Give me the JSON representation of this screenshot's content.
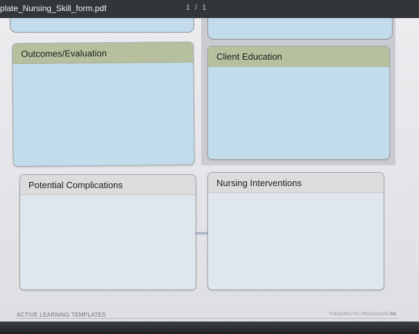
{
  "window": {
    "file_name": "plate_Nursing_Skill_form.pdf",
    "page_indicator": "1 / 1"
  },
  "boxes": {
    "outcomes": {
      "title": "Outcomes/Evaluation"
    },
    "client_education": {
      "title": "Client Education"
    },
    "potential_complications": {
      "title": "Potential Complications"
    },
    "nursing_interventions": {
      "title": "Nursing Interventions"
    }
  },
  "footer": {
    "left_label": "ACTIVE LEARNING TEMPLATES",
    "right_label": "THERAPEUTIC PROCEDURE",
    "page_number": "A9"
  },
  "colors": {
    "titlebar": "#323639",
    "box_header": "#b6c09e",
    "box_body": "#c3dceb",
    "page_background": "#e9e9eb"
  }
}
